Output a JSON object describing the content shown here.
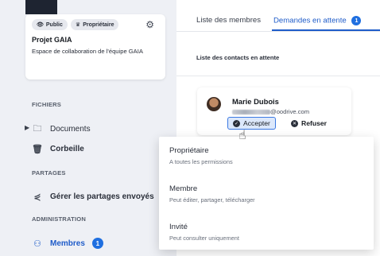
{
  "sidebar": {
    "badges": [
      {
        "label": "Public",
        "icon": "eye-icon"
      },
      {
        "label": "Propriétaire",
        "icon": "crown-icon"
      }
    ],
    "project_title": "Projet GAIA",
    "project_desc": "Espace de collaboration de l'équipe GAIA",
    "sections": {
      "files": "FICHIERS",
      "shares": "PARTAGES",
      "admin": "ADMINISTRATION"
    },
    "items": {
      "documents": "Documents",
      "trash": "Corbeille",
      "shares": "Gérer les partages envoyés",
      "members": "Membres",
      "members_count": "1"
    }
  },
  "tabs": [
    {
      "label": "Liste des membres",
      "active": false
    },
    {
      "label": "Demandes en attente",
      "active": true,
      "count": "1"
    }
  ],
  "list_header": "Liste des contacts en attente",
  "contact": {
    "name": "Marie Dubois",
    "email_domain": "@oodrive.com",
    "accept_label": "Accepter",
    "refuse_label": "Refuser"
  },
  "role_menu": [
    {
      "title": "Propriétaire",
      "subtitle": "A toutes les permissions"
    },
    {
      "title": "Membre",
      "subtitle": "Peut éditer, partager, télécharger"
    },
    {
      "title": "Invité",
      "subtitle": "Peut consulter uniquement"
    }
  ],
  "colors": {
    "accent": "#1f5cc9",
    "sidebar_bg": "#eef0f5"
  }
}
